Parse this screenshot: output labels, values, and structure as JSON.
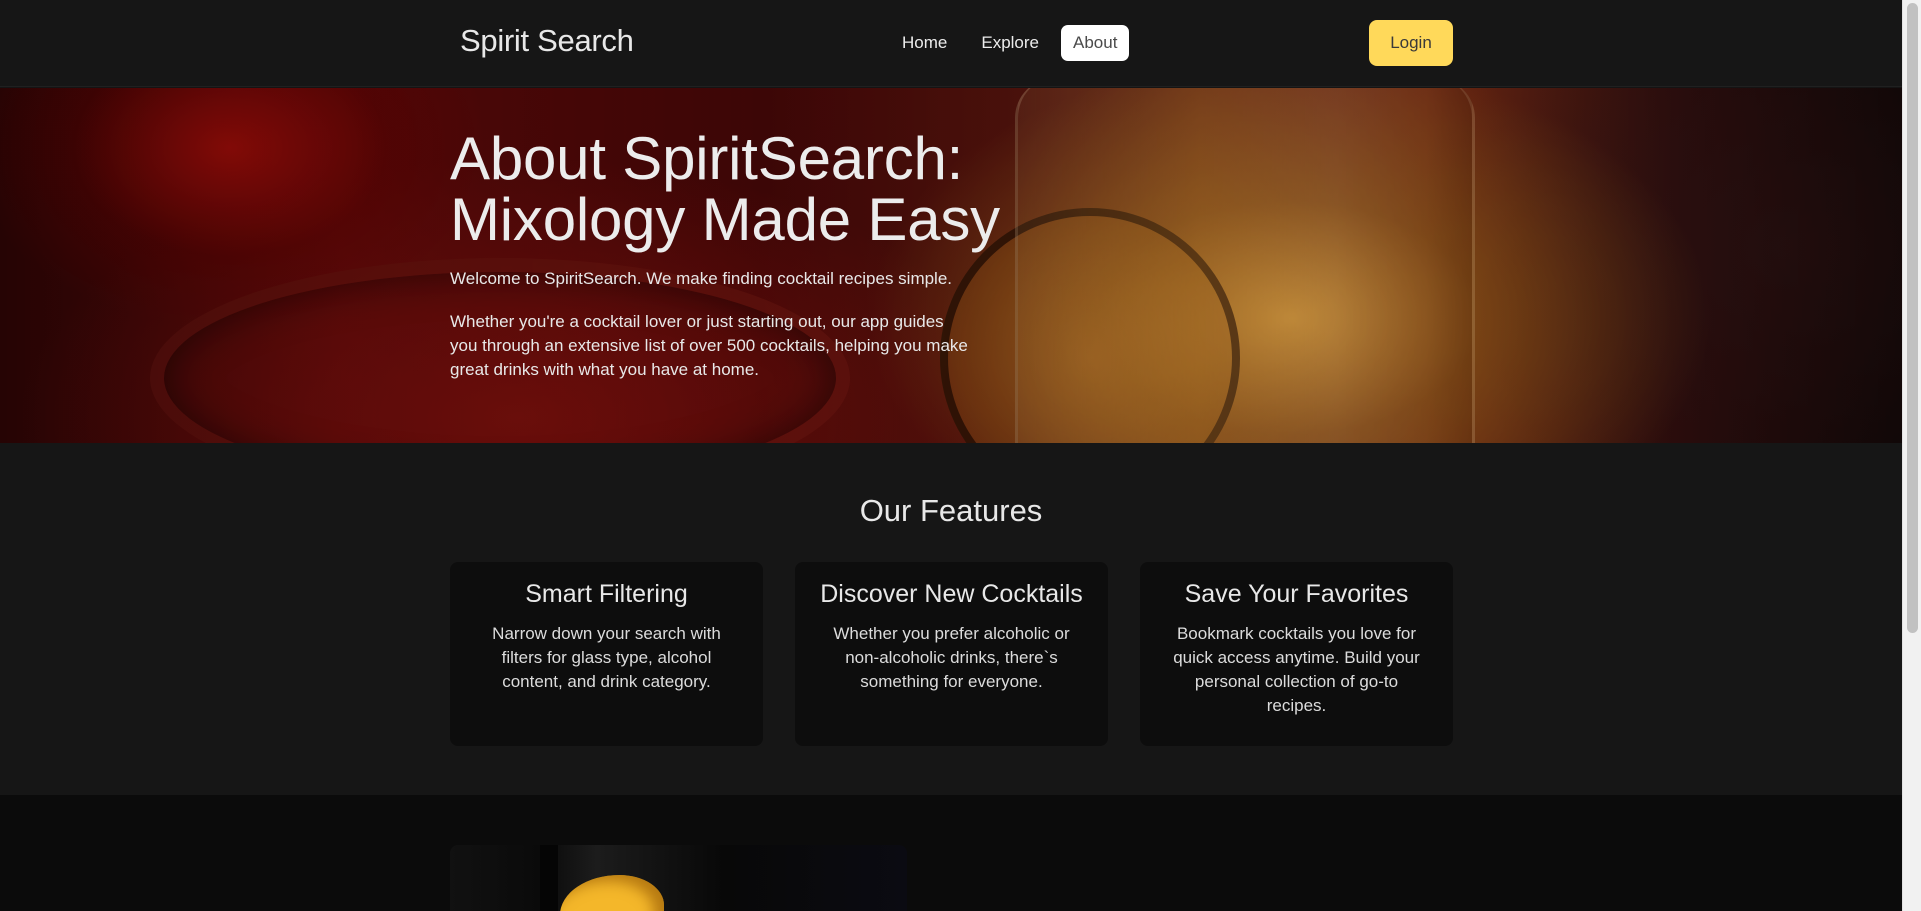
{
  "header": {
    "brand": "Spirit Search",
    "nav": [
      {
        "label": "Home",
        "active": false
      },
      {
        "label": "Explore",
        "active": false
      },
      {
        "label": "About",
        "active": true
      }
    ],
    "login_label": "Login",
    "login_color": "#ffd95a"
  },
  "hero": {
    "title": "About SpiritSearch: Mixology Made Easy",
    "intro": "Welcome to SpiritSearch. We make finding cocktail recipes simple.",
    "body": "Whether you're a cocktail lover or just starting out, our app guides you through an extensive list of over 500 cocktails, helping you make great drinks with what you have at home."
  },
  "features": {
    "title": "Our Features",
    "cards": [
      {
        "title": "Smart Filtering",
        "text": "Narrow down your search with filters for glass type, alcohol content, and drink category."
      },
      {
        "title": "Discover New Cocktails",
        "text": "Whether you prefer alcoholic or non-alcoholic drinks, there`s something for everyone."
      },
      {
        "title": "Save Your Favorites",
        "text": "Bookmark cocktails you love for quick access anytime. Build your personal collection of go-to recipes."
      }
    ]
  },
  "colors": {
    "background": "#141414",
    "card": "#0d0d0d",
    "accent": "#ffd95a"
  }
}
